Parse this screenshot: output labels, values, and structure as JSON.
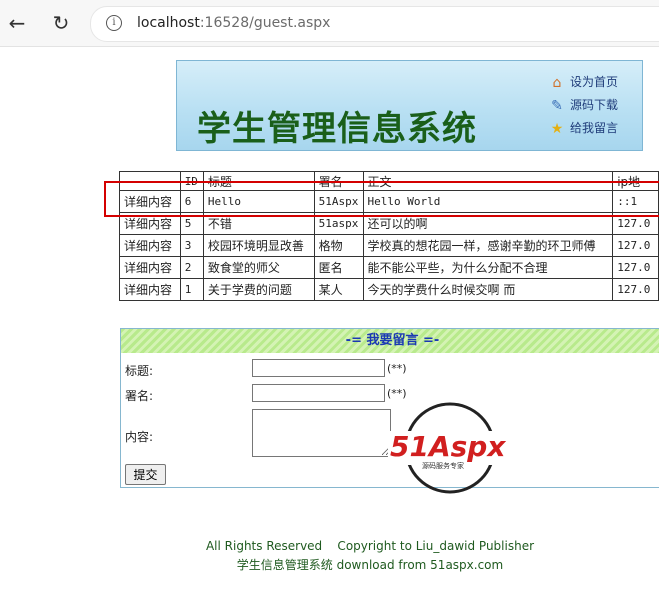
{
  "browser": {
    "url_host": "localhost",
    "url_rest": ":16528/guest.aspx"
  },
  "banner": {
    "title": "学生管理信息系统",
    "links": [
      "设为首页",
      "源码下载",
      "给我留言"
    ]
  },
  "table": {
    "headers": [
      "",
      "ID",
      "标题",
      "署名",
      "正文",
      "ip地"
    ],
    "rows": [
      {
        "action": "详细内容",
        "id": "6",
        "title": "Hello",
        "author": "51Aspx",
        "body": "Hello World",
        "ip": "::1"
      },
      {
        "action": "详细内容",
        "id": "5",
        "title": "不错",
        "author": "51aspx",
        "body": "还可以的啊",
        "ip": "127.0"
      },
      {
        "action": "详细内容",
        "id": "3",
        "title": "校园环境明显改善",
        "author": "格物",
        "body": "学校真的想花园一样，感谢辛勤的环卫师傅",
        "ip": "127.0"
      },
      {
        "action": "详细内容",
        "id": "2",
        "title": "致食堂的师父",
        "author": "匿名",
        "body": "能不能公平些，为什么分配不合理",
        "ip": "127.0"
      },
      {
        "action": "详细内容",
        "id": "1",
        "title": "关于学费的问题",
        "author": "某人",
        "body": "今天的学费什么时候交啊 而",
        "ip": "127.0"
      }
    ]
  },
  "form": {
    "heading": "-= 我要留言 =-",
    "title_label": "标题:",
    "author_label": "署名:",
    "content_label": "内容:",
    "required_mark": "(**)",
    "title_value": "",
    "author_value": "",
    "content_value": "",
    "submit_label": "提交"
  },
  "watermark": {
    "brand": "51Aspx",
    "tagline": "源码服务专家"
  },
  "footer": {
    "line1": "All Rights Reserved    Copyright to Liu_dawid Publisher",
    "line2": "学生信息管理系统 download from 51aspx.com"
  }
}
